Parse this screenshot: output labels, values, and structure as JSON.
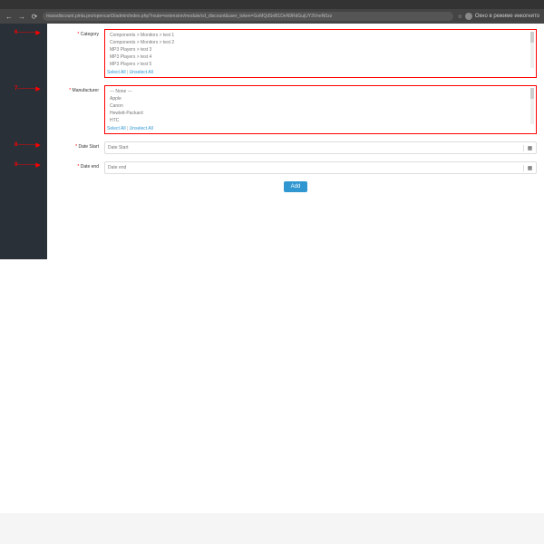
{
  "url": "massdiscount.pinta.pro/opencart3/admin/index.php?route=extension/module/cd_discount&user_token=GoMQdSnB1DeN9RdGujUY3VneN0zz",
  "profile": "Окно в режиме инкогнито",
  "category": {
    "label": "Category",
    "items": [
      "Components > Monitors > test 1",
      "Components > Monitors > test 2",
      "MP3 Players > test 3",
      "MP3 Players > test 4",
      "MP3 Players > test 5"
    ],
    "selectAll": "Select All",
    "unselectAll": "Unselect All"
  },
  "manufacturer": {
    "label": "Manufacturer",
    "items": [
      "--- None ---",
      "Apple",
      "Canon",
      "Hewlett-Packard",
      "HTC"
    ],
    "selectAll": "Select All",
    "unselectAll": "Unselect All"
  },
  "dateStart": {
    "label": "Date Start",
    "placeholder": "Date Start"
  },
  "dateEnd": {
    "label": "Date end",
    "placeholder": "Date end"
  },
  "add": "Add",
  "markers": [
    "6",
    "7",
    "8",
    "9"
  ]
}
